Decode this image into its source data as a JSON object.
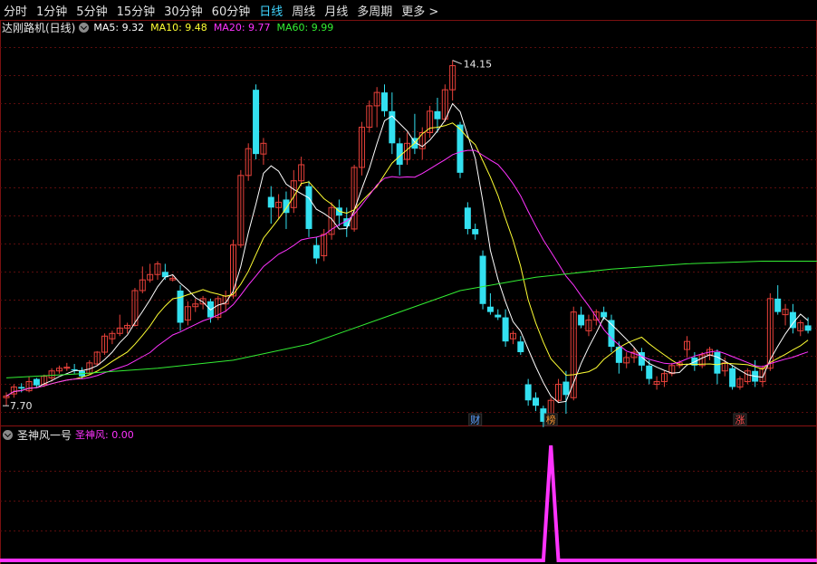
{
  "toolbar": {
    "tabs": [
      {
        "label": "分时"
      },
      {
        "label": "1分钟"
      },
      {
        "label": "5分钟"
      },
      {
        "label": "15分钟"
      },
      {
        "label": "30分钟"
      },
      {
        "label": "60分钟"
      },
      {
        "label": "日线",
        "active": true
      },
      {
        "label": "周线"
      },
      {
        "label": "月线"
      },
      {
        "label": "多周期"
      },
      {
        "label": "更多 >"
      }
    ]
  },
  "main_panel": {
    "title": "达刚路机(日线)",
    "ma": [
      {
        "label": "MA5: 9.32",
        "color": "#ffffff"
      },
      {
        "label": "MA10: 9.48",
        "color": "#ffff33"
      },
      {
        "label": "MA20: 9.77",
        "color": "#ff33ff"
      },
      {
        "label": "MA60: 9.99",
        "color": "#33ee33"
      }
    ],
    "high_label": "14.15",
    "low_label": "7.70",
    "markers": [
      {
        "text": "财",
        "color": "#5aa0ff",
        "idx": 62
      },
      {
        "text": "榜",
        "color": "#ff9933",
        "idx": 72
      },
      {
        "text": "涨",
        "color": "#ff4d4d",
        "idx": 97
      }
    ]
  },
  "sub_panel": {
    "title": "圣神风一号",
    "value_label": "圣神风: 0.00",
    "line_color": "#ff33ff"
  },
  "chart_data": {
    "type": "candlestick",
    "title": "达刚路机(日线)",
    "ylim": [
      7.5,
      14.6
    ],
    "candles": [
      [
        7.85,
        7.95,
        7.7,
        7.88
      ],
      [
        7.92,
        8.1,
        7.85,
        8.05
      ],
      [
        8.05,
        8.12,
        7.95,
        8.02
      ],
      [
        7.98,
        8.25,
        7.95,
        8.15
      ],
      [
        8.2,
        8.22,
        8.05,
        8.08
      ],
      [
        8.1,
        8.28,
        8.05,
        8.25
      ],
      [
        8.22,
        8.4,
        8.15,
        8.35
      ],
      [
        8.35,
        8.45,
        8.3,
        8.4
      ],
      [
        8.4,
        8.5,
        8.35,
        8.42
      ],
      [
        8.38,
        8.48,
        8.3,
        8.36
      ],
      [
        8.35,
        8.42,
        8.2,
        8.25
      ],
      [
        8.3,
        8.55,
        8.28,
        8.5
      ],
      [
        8.48,
        8.72,
        8.45,
        8.7
      ],
      [
        8.7,
        9.05,
        8.65,
        9.0
      ],
      [
        8.95,
        9.1,
        8.85,
        9.05
      ],
      [
        9.05,
        9.4,
        9.0,
        9.15
      ],
      [
        9.15,
        9.25,
        9.05,
        9.2
      ],
      [
        9.2,
        9.9,
        9.18,
        9.85
      ],
      [
        9.85,
        10.3,
        9.8,
        10.05
      ],
      [
        10.05,
        10.35,
        10.0,
        10.15
      ],
      [
        10.15,
        10.4,
        10.05,
        10.35
      ],
      [
        10.2,
        10.35,
        10.05,
        10.1
      ],
      [
        10.05,
        10.15,
        10.02,
        10.08
      ],
      [
        9.85,
        9.95,
        9.1,
        9.25
      ],
      [
        9.3,
        9.65,
        9.2,
        9.55
      ],
      [
        9.55,
        9.7,
        9.45,
        9.6
      ],
      [
        9.6,
        9.75,
        9.5,
        9.7
      ],
      [
        9.65,
        9.7,
        9.25,
        9.35
      ],
      [
        9.35,
        9.75,
        9.3,
        9.7
      ],
      [
        9.6,
        9.85,
        9.45,
        9.75
      ],
      [
        9.75,
        10.8,
        9.7,
        10.7
      ],
      [
        10.7,
        12.1,
        10.65,
        12.0
      ],
      [
        12.0,
        12.6,
        11.9,
        12.5
      ],
      [
        13.6,
        13.7,
        12.3,
        12.4
      ],
      [
        12.4,
        12.7,
        12.2,
        12.6
      ],
      [
        11.6,
        11.8,
        11.1,
        11.4
      ],
      [
        11.4,
        11.65,
        11.2,
        11.5
      ],
      [
        11.55,
        11.7,
        11.0,
        11.3
      ],
      [
        11.4,
        12.1,
        11.3,
        11.9
      ],
      [
        11.9,
        12.35,
        11.8,
        12.2
      ],
      [
        11.8,
        11.9,
        10.85,
        11.0
      ],
      [
        10.7,
        10.85,
        10.35,
        10.45
      ],
      [
        10.5,
        11.0,
        10.4,
        10.9
      ],
      [
        10.9,
        11.5,
        10.8,
        11.4
      ],
      [
        11.4,
        11.55,
        11.05,
        11.25
      ],
      [
        11.2,
        11.4,
        10.85,
        11.05
      ],
      [
        11.0,
        12.2,
        10.95,
        12.15
      ],
      [
        12.15,
        13.0,
        12.0,
        12.9
      ],
      [
        12.9,
        13.4,
        12.8,
        13.3
      ],
      [
        13.3,
        13.65,
        12.9,
        13.55
      ],
      [
        13.55,
        13.7,
        13.1,
        13.2
      ],
      [
        13.2,
        13.55,
        12.4,
        12.6
      ],
      [
        12.6,
        12.7,
        12.0,
        12.2
      ],
      [
        12.3,
        12.8,
        12.2,
        12.6
      ],
      [
        12.7,
        13.15,
        12.4,
        12.5
      ],
      [
        12.5,
        12.9,
        12.3,
        12.8
      ],
      [
        12.8,
        13.3,
        12.7,
        13.2
      ],
      [
        13.2,
        13.45,
        12.8,
        13.05
      ],
      [
        13.05,
        13.7,
        13.0,
        13.6
      ],
      [
        13.6,
        14.15,
        13.4,
        14.05
      ],
      [
        12.95,
        13.0,
        11.95,
        12.05
      ],
      [
        11.4,
        11.5,
        10.9,
        11.0
      ],
      [
        11.0,
        11.1,
        10.8,
        10.9
      ],
      [
        10.5,
        10.6,
        9.5,
        9.6
      ],
      [
        9.55,
        9.8,
        9.4,
        9.45
      ],
      [
        9.4,
        9.5,
        9.3,
        9.35
      ],
      [
        9.35,
        9.5,
        8.8,
        8.9
      ],
      [
        8.95,
        9.1,
        8.85,
        9.05
      ],
      [
        8.9,
        9.0,
        8.65,
        8.7
      ],
      [
        8.1,
        8.2,
        7.7,
        7.8
      ],
      [
        7.85,
        7.95,
        7.6,
        7.7
      ],
      [
        7.65,
        7.7,
        7.3,
        7.4
      ],
      [
        7.5,
        7.85,
        7.45,
        7.8
      ],
      [
        7.8,
        8.2,
        7.75,
        8.1
      ],
      [
        8.15,
        8.35,
        7.55,
        7.9
      ],
      [
        7.85,
        9.55,
        7.8,
        9.45
      ],
      [
        9.4,
        9.55,
        9.15,
        9.2
      ],
      [
        9.1,
        9.4,
        9.0,
        9.3
      ],
      [
        9.3,
        9.5,
        9.2,
        9.45
      ],
      [
        9.45,
        9.55,
        9.3,
        9.35
      ],
      [
        9.3,
        9.4,
        8.7,
        8.8
      ],
      [
        8.8,
        8.9,
        8.3,
        8.5
      ],
      [
        8.5,
        8.7,
        8.4,
        8.6
      ],
      [
        8.6,
        8.8,
        8.5,
        8.7
      ],
      [
        8.7,
        8.78,
        8.35,
        8.45
      ],
      [
        8.45,
        8.55,
        8.1,
        8.2
      ],
      [
        8.1,
        8.25,
        8.0,
        8.15
      ],
      [
        8.15,
        8.35,
        8.05,
        8.3
      ],
      [
        8.3,
        8.5,
        8.25,
        8.45
      ],
      [
        8.45,
        8.55,
        8.4,
        8.5
      ],
      [
        8.75,
        9.0,
        8.6,
        8.9
      ],
      [
        8.6,
        8.7,
        8.35,
        8.45
      ],
      [
        8.45,
        8.7,
        8.4,
        8.65
      ],
      [
        8.65,
        8.8,
        8.55,
        8.75
      ],
      [
        8.7,
        8.75,
        8.1,
        8.3
      ],
      [
        8.35,
        8.6,
        8.25,
        8.5
      ],
      [
        8.4,
        8.45,
        8.0,
        8.05
      ],
      [
        8.05,
        8.25,
        8.0,
        8.2
      ],
      [
        8.15,
        8.4,
        8.1,
        8.35
      ],
      [
        8.35,
        8.55,
        8.05,
        8.15
      ],
      [
        8.15,
        8.45,
        8.05,
        8.4
      ],
      [
        8.4,
        9.8,
        8.35,
        9.7
      ],
      [
        9.7,
        9.95,
        9.4,
        9.45
      ],
      [
        9.4,
        9.6,
        9.2,
        9.5
      ],
      [
        9.45,
        9.6,
        9.05,
        9.15
      ],
      [
        9.1,
        9.3,
        9.0,
        9.25
      ],
      [
        9.2,
        9.35,
        9.05,
        9.1
      ]
    ],
    "ma60_path": [
      [
        0,
        8.22
      ],
      [
        10,
        8.3
      ],
      [
        20,
        8.4
      ],
      [
        30,
        8.55
      ],
      [
        40,
        8.85
      ],
      [
        50,
        9.35
      ],
      [
        60,
        9.85
      ],
      [
        70,
        10.1
      ],
      [
        80,
        10.25
      ],
      [
        90,
        10.35
      ],
      [
        100,
        10.4
      ],
      [
        106,
        10.4
      ]
    ],
    "indicator": {
      "name": "圣神风",
      "values_nonzero": [
        {
          "idx": 72,
          "value": 1
        }
      ],
      "range": [
        0,
        1
      ]
    }
  }
}
